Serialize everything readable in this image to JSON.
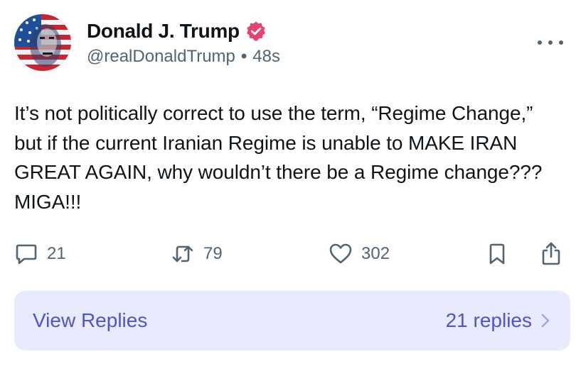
{
  "author": {
    "display_name": "Donald J. Trump",
    "handle": "@realDonaldTrump",
    "separator": "•",
    "timestamp": "48s",
    "verified_color": "#e9426e"
  },
  "post": {
    "text": "It’s not politically correct to use the term, “Regime Change,” but if the current Iranian Regime is unable to MAKE IRAN GREAT AGAIN, why wouldn’t there be a Regime change??? MIGA!!!"
  },
  "actions": {
    "replies_count": "21",
    "reposts_count": "79",
    "likes_count": "302",
    "icon_color": "#536471"
  },
  "replies_bar": {
    "label": "View Replies",
    "count_label": "21 replies",
    "background": "#e8eafe",
    "text_color": "#4f55c9"
  }
}
